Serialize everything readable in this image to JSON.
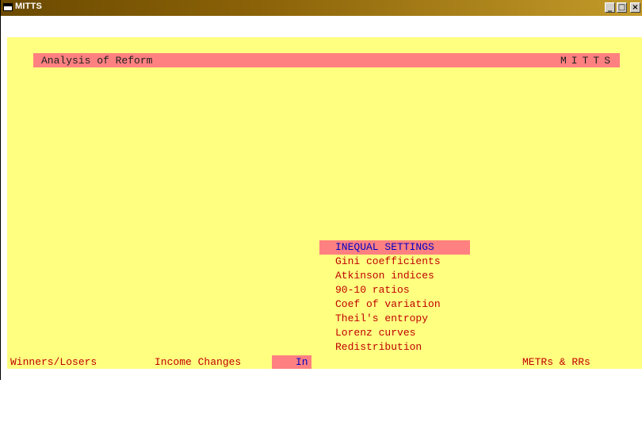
{
  "window": {
    "title": "MITTS",
    "buttons": {
      "minimize": "_",
      "maximize": "□",
      "close": "×"
    }
  },
  "header": {
    "title": "Analysis of Reform",
    "brand": "MITTS"
  },
  "menu": {
    "items": [
      {
        "label": "INEQUAL SETTINGS",
        "selected": true
      },
      {
        "label": "Gini coefficients",
        "selected": false
      },
      {
        "label": "Atkinson indices",
        "selected": false
      },
      {
        "label": "90-10 ratios",
        "selected": false
      },
      {
        "label": "Coef of variation",
        "selected": false
      },
      {
        "label": "Theil's entropy",
        "selected": false
      },
      {
        "label": "Lorenz curves",
        "selected": false
      },
      {
        "label": "Redistribution",
        "selected": false
      }
    ]
  },
  "bottom_menu": {
    "items": [
      {
        "label": "Winners/Losers"
      },
      {
        "label": "Income Changes"
      },
      {
        "label": "In",
        "active": true
      },
      {
        "label": "METRs & RRs"
      }
    ]
  },
  "colors": {
    "background": "#ffff80",
    "highlight": "#ff8080",
    "text": "#c00000",
    "selected_text": "#0000c0"
  }
}
